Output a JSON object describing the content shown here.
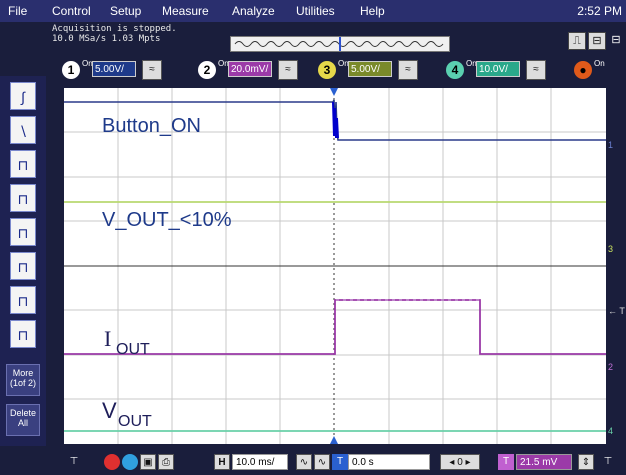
{
  "menu": [
    "File",
    "Control",
    "Setup",
    "Measure",
    "Analyze",
    "Utilities",
    "Help"
  ],
  "clock": "2:52 PM",
  "status": {
    "line1": "Acquisition is stopped.",
    "line2": "10.0 MSa/s  1.03 Mpts"
  },
  "channels": [
    {
      "num": "1",
      "on": "On",
      "scale": "5.00V/",
      "color": "#1e3a8a"
    },
    {
      "num": "2",
      "on": "On",
      "scale": "20.0mV/",
      "color": "#9b3aa8"
    },
    {
      "num": "3",
      "on": "On",
      "scale": "5.00V/",
      "color": "#7a8a2a"
    },
    {
      "num": "4",
      "on": "On",
      "scale": "10.0V/",
      "color": "#2aa88a"
    }
  ],
  "math": {
    "on": "On"
  },
  "side_buttons": {
    "more": "More (1of 2)",
    "delete": "Delete All"
  },
  "traces": {
    "button_on": "Button_ON",
    "v_out_pct": "V_OUT_<10%",
    "i_out_main": "I",
    "i_out_sub": "OUT",
    "v_out_main": "V",
    "v_out_sub": "OUT"
  },
  "markers": {
    "ch1": "1",
    "ch3": "3",
    "trig": "← T",
    "ch2": "2",
    "ch4": "4"
  },
  "bottom": {
    "h_label": "H",
    "timebase": "10.0 ms/",
    "t_label": "T",
    "delay": "0.0 s",
    "trig_level_label": "T",
    "trig_level": "21.5 mV"
  }
}
